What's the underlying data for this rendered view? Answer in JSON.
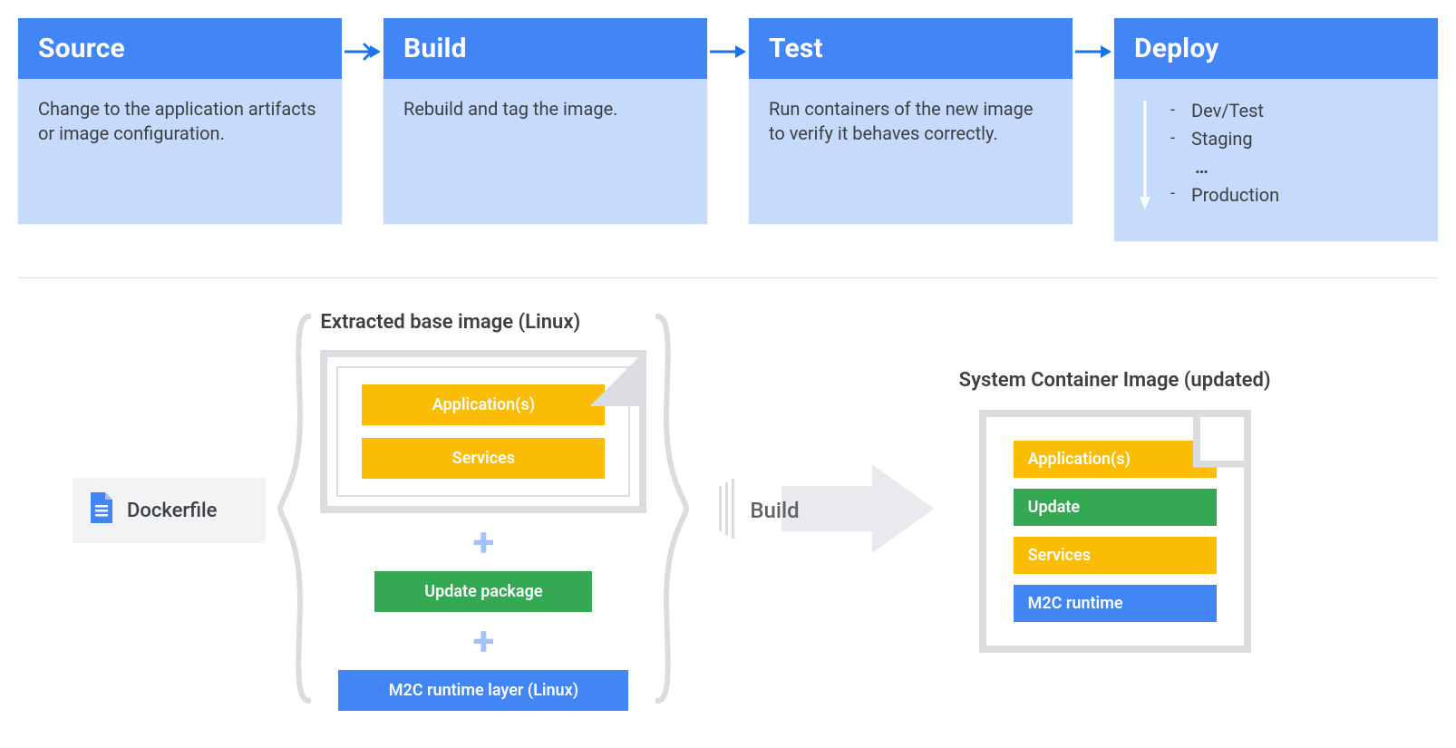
{
  "pipeline": {
    "stages": [
      {
        "title": "Source",
        "body": "Change to the application artifacts or image configuration."
      },
      {
        "title": "Build",
        "body": "Rebuild and tag the image."
      },
      {
        "title": "Test",
        "body": "Run containers of the new image to verify it behaves correctly."
      },
      {
        "title": "Deploy"
      }
    ],
    "deploy_items": [
      "Dev/Test",
      "Staging",
      "…",
      "Production"
    ]
  },
  "lower": {
    "dockerfile_label": "Dockerfile",
    "center_title": "Extracted base image (Linux)",
    "inner_chips": {
      "apps": "Application(s)",
      "services": "Services"
    },
    "update_chip": "Update package",
    "runtime_chip": "M2C runtime layer (Linux)",
    "build_label": "Build",
    "output_title": "System Container Image (updated)",
    "output_chips": {
      "apps": "Application(s)",
      "update": "Update",
      "services": "Services",
      "runtime": "M2C runtime"
    }
  },
  "colors": {
    "blue_header": "#4285F4",
    "blue_lightbg": "#C6DAFC",
    "orange": "#FBBC04",
    "green": "#34A853",
    "blue_chip": "#4285F4"
  }
}
